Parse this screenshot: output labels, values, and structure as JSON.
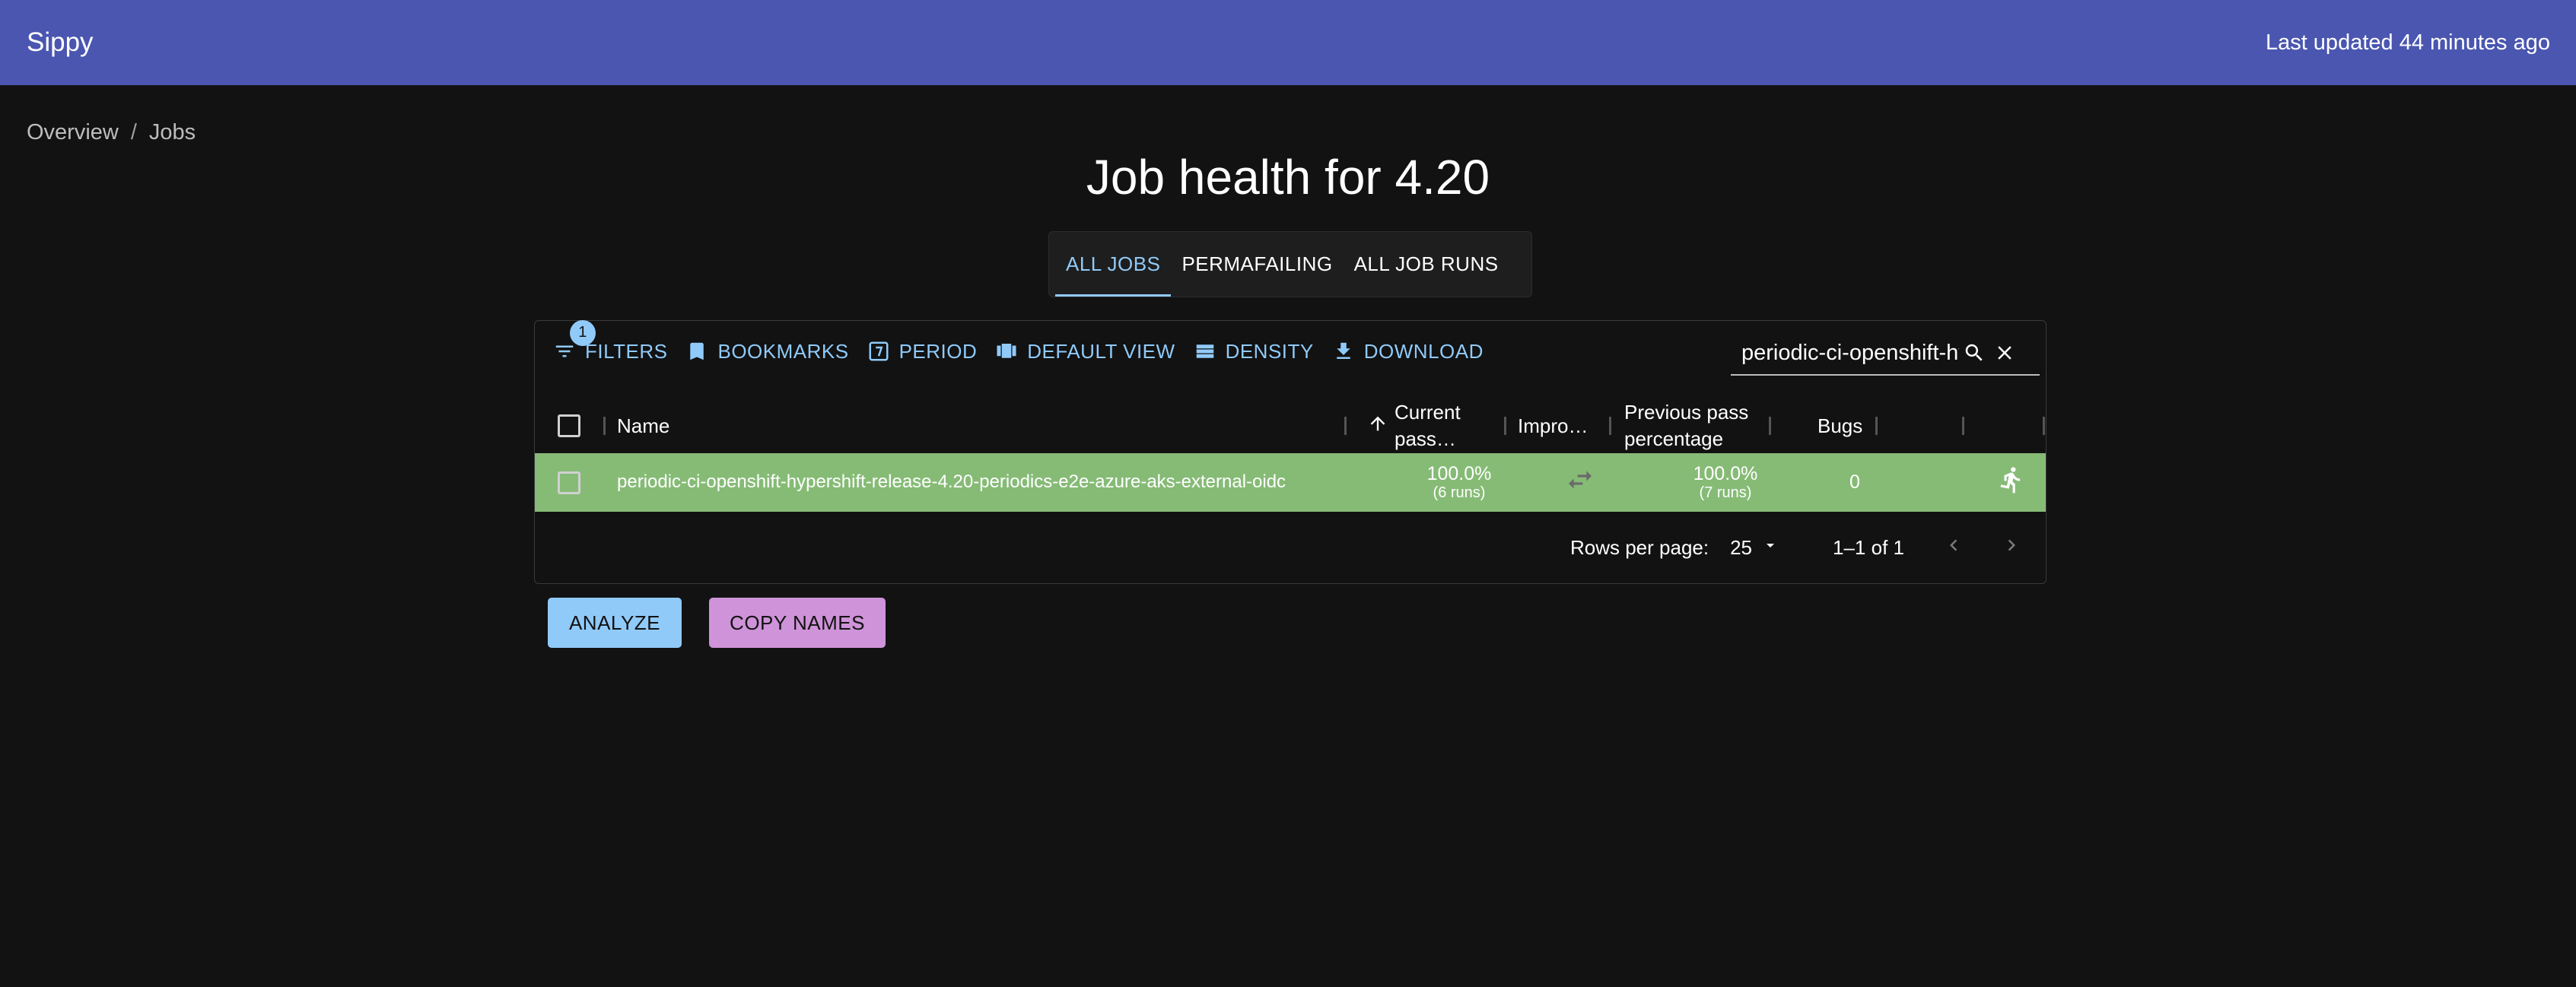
{
  "appbar": {
    "title": "Sippy",
    "last_updated": "Last updated 44 minutes ago"
  },
  "breadcrumb": [
    "Overview",
    "Jobs"
  ],
  "page_title": "Job health for 4.20",
  "tabs": [
    {
      "label": "ALL JOBS",
      "active": true
    },
    {
      "label": "PERMAFAILING",
      "active": false
    },
    {
      "label": "ALL JOB RUNS",
      "active": false
    }
  ],
  "toolbar": {
    "filters_label": "FILTERS",
    "filters_badge": "1",
    "bookmarks_label": "BOOKMARKS",
    "period_label": "PERIOD",
    "default_view_label": "DEFAULT VIEW",
    "density_label": "DENSITY",
    "download_label": "DOWNLOAD",
    "search_value": "periodic-ci-openshift-hypershift"
  },
  "columns": {
    "name": "Name",
    "current_pass": "Current pass…",
    "improvement": "Impro…",
    "previous_pass": "Previous pass percentage",
    "bugs": "Bugs"
  },
  "rows": [
    {
      "name": "periodic-ci-openshift-hypershift-release-4.20-periodics-e2e-azure-aks-external-oidc",
      "current_pass": "100.0%",
      "current_runs": "(6 runs)",
      "previous_pass": "100.0%",
      "previous_runs": "(7 runs)",
      "bugs": "0"
    }
  ],
  "footer": {
    "rows_per_page_label": "Rows per page:",
    "rows_per_page_value": "25",
    "range": "1–1 of 1"
  },
  "actions": {
    "analyze_label": "ANALYZE",
    "copy_names_label": "COPY NAMES"
  },
  "colors": {
    "appbar": "#4a56b0",
    "background": "#121212",
    "accent": "#90caf9",
    "row_pass": "#86bb76",
    "copy_button": "#ce93d8"
  }
}
